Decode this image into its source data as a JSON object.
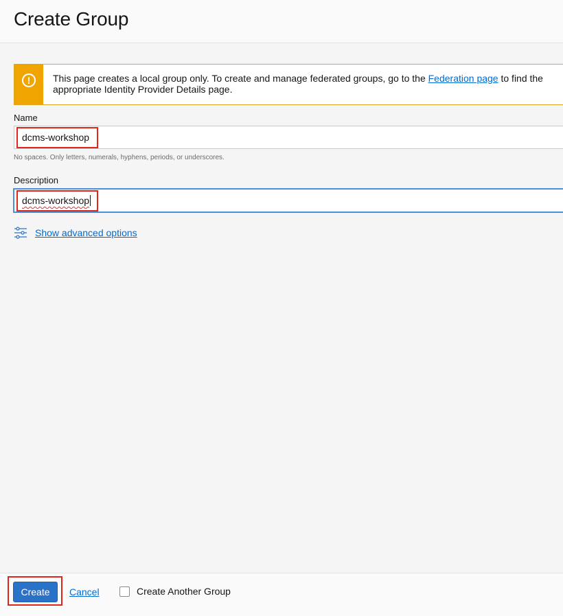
{
  "header": {
    "title": "Create Group"
  },
  "alert": {
    "text_before": "This page creates a local group only. To create and manage federated groups, go to the ",
    "link_text": "Federation page",
    "text_after": " to find the appropriate Identity Provider Details page.",
    "icon": "warning-icon",
    "accent_color": "#f0a400"
  },
  "form": {
    "name_label": "Name",
    "name_value": "dcms-workshop",
    "name_hint": "No spaces. Only letters, numerals, hyphens, periods, or underscores.",
    "description_label": "Description",
    "description_value": "dcms-workshop",
    "advanced_link": "Show advanced options",
    "advanced_icon": "sliders-icon"
  },
  "footer": {
    "create_label": "Create",
    "cancel_label": "Cancel",
    "create_another_label": "Create Another Group",
    "create_another_checked": false
  },
  "colors": {
    "primary": "#2a71c8",
    "link": "#006bd3",
    "highlight": "#e0251b"
  }
}
